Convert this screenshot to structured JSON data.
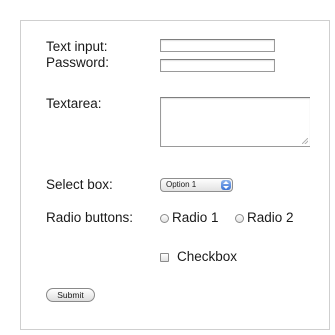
{
  "form": {
    "text_input_label": "Text input:",
    "text_input_value": "",
    "password_label": "Password:",
    "password_value": "",
    "textarea_label": "Textarea:",
    "textarea_value": "",
    "select_label": "Select box:",
    "select_value": "Option 1",
    "radio_label": "Radio buttons:",
    "radio_options": [
      "Radio 1",
      "Radio 2"
    ],
    "checkbox_label": "Checkbox",
    "submit_label": "Submit"
  }
}
